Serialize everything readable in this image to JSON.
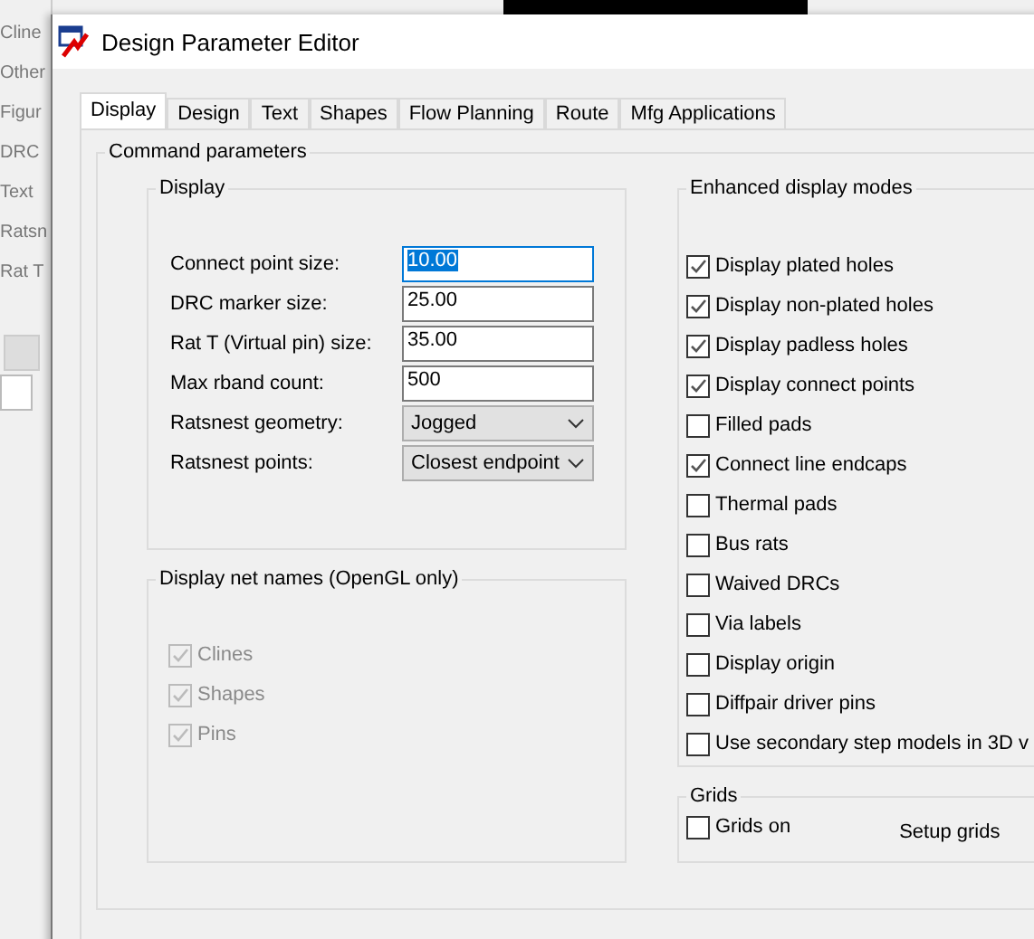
{
  "background_window": {
    "items": [
      "Cline",
      "Other",
      "Figur",
      "DRC",
      "Text",
      "Ratsn",
      "Rat T"
    ]
  },
  "window": {
    "title": "Design Parameter Editor"
  },
  "tabs": [
    {
      "label": "Display",
      "selected": true
    },
    {
      "label": "Design",
      "selected": false
    },
    {
      "label": "Text",
      "selected": false
    },
    {
      "label": "Shapes",
      "selected": false
    },
    {
      "label": "Flow Planning",
      "selected": false
    },
    {
      "label": "Route",
      "selected": false
    },
    {
      "label": "Mfg Applications",
      "selected": false
    }
  ],
  "command_parameters": {
    "title": "Command parameters",
    "display": {
      "title": "Display",
      "fields": [
        {
          "kind": "input",
          "label": "Connect point size:",
          "value": "10.00",
          "selected": true
        },
        {
          "kind": "input",
          "label": "DRC marker size:",
          "value": "25.00",
          "selected": false
        },
        {
          "kind": "input",
          "label": "Rat T (Virtual pin) size:",
          "value": "35.00",
          "selected": false
        },
        {
          "kind": "input",
          "label": "Max rband count:",
          "value": "500",
          "selected": false
        },
        {
          "kind": "dropdown",
          "label": "Ratsnest geometry:",
          "value": "Jogged"
        },
        {
          "kind": "dropdown",
          "label": "Ratsnest points:",
          "value": "Closest endpoint"
        }
      ]
    },
    "net_names": {
      "title": "Display net names (OpenGL only)",
      "items": [
        {
          "label": "Clines",
          "checked": true,
          "disabled": true
        },
        {
          "label": "Shapes",
          "checked": true,
          "disabled": true
        },
        {
          "label": "Pins",
          "checked": true,
          "disabled": true
        }
      ]
    },
    "enhanced": {
      "title": "Enhanced display modes",
      "items": [
        {
          "label": "Display plated holes",
          "checked": true
        },
        {
          "label": "Display non-plated holes",
          "checked": true
        },
        {
          "label": "Display padless holes",
          "checked": true
        },
        {
          "label": "Display connect points",
          "checked": true
        },
        {
          "label": "Filled pads",
          "checked": false
        },
        {
          "label": "Connect line endcaps",
          "checked": true
        },
        {
          "label": "Thermal pads",
          "checked": false
        },
        {
          "label": "Bus rats",
          "checked": false
        },
        {
          "label": "Waived DRCs",
          "checked": false
        },
        {
          "label": "Via labels",
          "checked": false
        },
        {
          "label": "Display origin",
          "checked": false
        },
        {
          "label": "Diffpair driver pins",
          "checked": false
        },
        {
          "label": "Use secondary step models in 3D v",
          "checked": false
        }
      ]
    },
    "grids": {
      "title": "Grids",
      "checkbox": {
        "label": "Grids on",
        "checked": false
      },
      "button": "Setup grids"
    }
  }
}
